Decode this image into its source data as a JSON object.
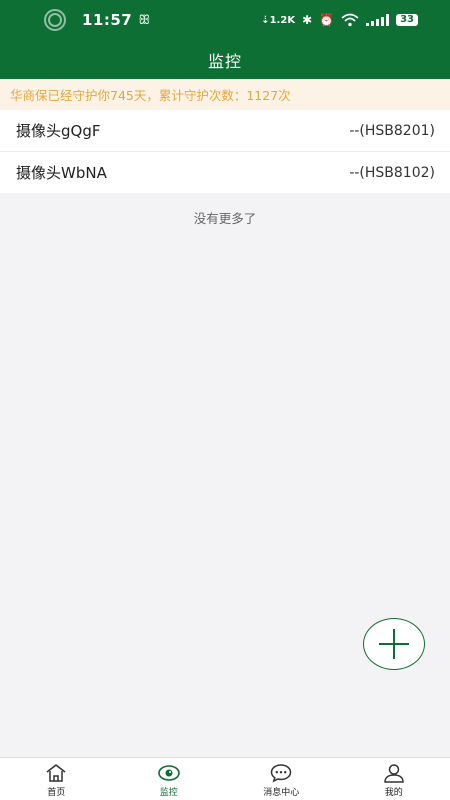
{
  "status_bar": {
    "time": "11:57",
    "net_glyph": "ꕥ",
    "speed": "⇣1.2K",
    "bluetooth_glyph": "✱",
    "alarm_glyph": "⏰",
    "battery": "33"
  },
  "header": {
    "title": "监控"
  },
  "notice": {
    "text": "华商保已经守护你745天，累计守护次数：1127次"
  },
  "devices": [
    {
      "name": "摄像头gQgF",
      "code": "--(HSB8201)"
    },
    {
      "name": "摄像头WbNA",
      "code": "--(HSB8102)"
    }
  ],
  "list_footer": "没有更多了",
  "tabbar": {
    "items": [
      {
        "label": "首页",
        "icon": "home-icon"
      },
      {
        "label": "监控",
        "icon": "eye-icon"
      },
      {
        "label": "消息中心",
        "icon": "chat-icon"
      },
      {
        "label": "我的",
        "icon": "user-icon"
      }
    ],
    "active_index": 1
  },
  "colors": {
    "primary": "#0e6f35",
    "notice_bg": "#fcf3e6",
    "notice_text": "#e8a53a"
  }
}
